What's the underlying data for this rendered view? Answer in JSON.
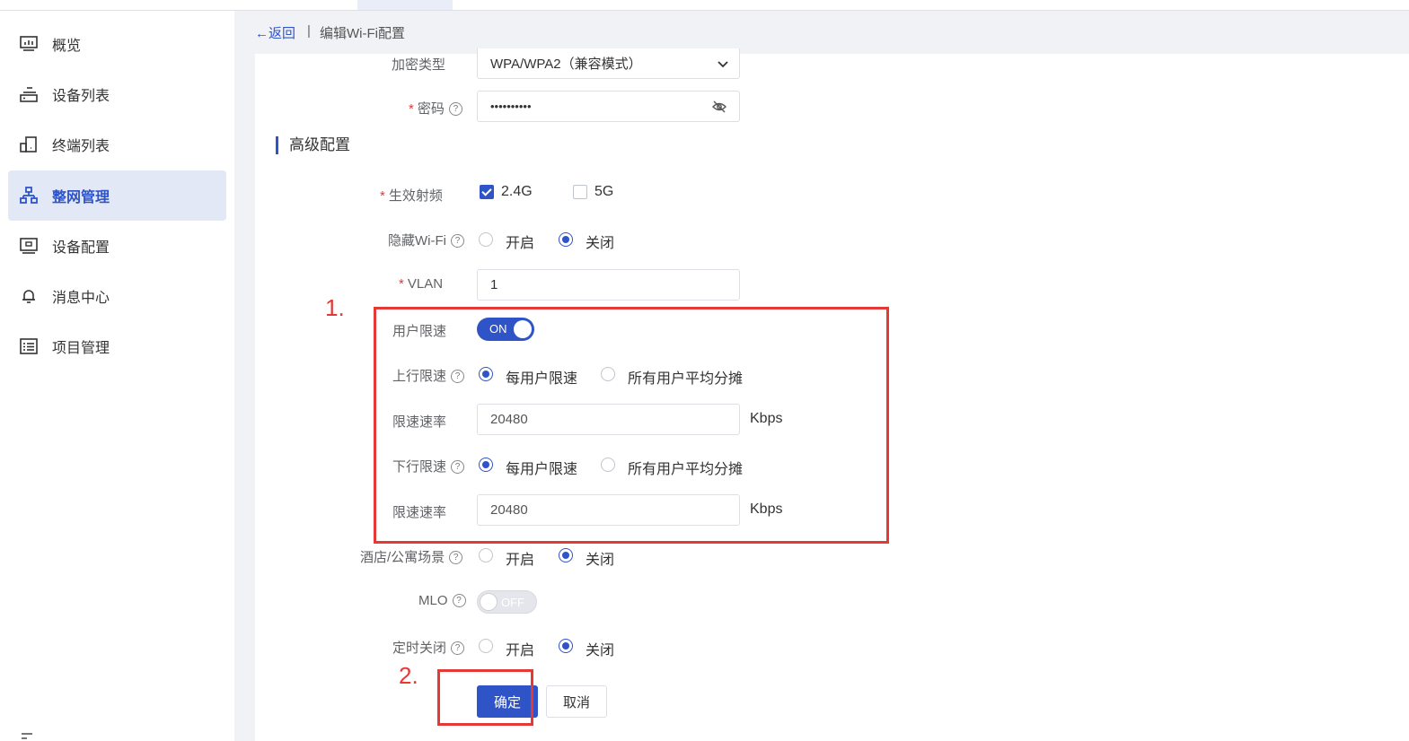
{
  "sidebar": {
    "items": [
      {
        "label": "概览",
        "icon": "monitor-chart-icon"
      },
      {
        "label": "设备列表",
        "icon": "device-stack-icon"
      },
      {
        "label": "终端列表",
        "icon": "terminal-device-icon"
      },
      {
        "label": "整网管理",
        "icon": "network-topology-icon",
        "active": true
      },
      {
        "label": "设备配置",
        "icon": "device-config-icon"
      },
      {
        "label": "消息中心",
        "icon": "bell-icon"
      },
      {
        "label": "项目管理",
        "icon": "list-icon"
      }
    ]
  },
  "breadcrumb": {
    "back": "←返回",
    "separator": "|",
    "current": "编辑Wi-Fi配置"
  },
  "form": {
    "encryption": {
      "label": "加密类型",
      "value": "WPA/WPA2（兼容模式）"
    },
    "password": {
      "required": "*",
      "label": "密码",
      "help": "?",
      "value": "••••••••••"
    },
    "advanced_title": "高级配置",
    "band": {
      "required": "*",
      "label": "生效射频",
      "options": [
        {
          "label": "2.4G",
          "checked": true
        },
        {
          "label": "5G",
          "checked": false
        }
      ]
    },
    "hide_wifi": {
      "label": "隐藏Wi-Fi",
      "help": "?",
      "on_label": "开启",
      "off_label": "关闭",
      "selected": "关闭"
    },
    "vlan": {
      "required": "*",
      "label": "VLAN",
      "value": "1"
    },
    "user_limit": {
      "label": "用户限速",
      "state": "ON"
    },
    "up_limit": {
      "label": "上行限速",
      "help": "?",
      "opt1": "每用户限速",
      "opt2": "所有用户平均分摊",
      "selected": "每用户限速"
    },
    "up_rate": {
      "label": "限速速率",
      "value": "20480",
      "unit": "Kbps"
    },
    "down_limit": {
      "label": "下行限速",
      "help": "?",
      "opt1": "每用户限速",
      "opt2": "所有用户平均分摊",
      "selected": "每用户限速"
    },
    "down_rate": {
      "label": "限速速率",
      "value": "20480",
      "unit": "Kbps"
    },
    "hotel": {
      "label": "酒店/公寓场景",
      "help": "?",
      "on_label": "开启",
      "off_label": "关闭",
      "selected": "关闭"
    },
    "mlo": {
      "label": "MLO",
      "help": "?",
      "state": "OFF"
    },
    "timer_off": {
      "label": "定时关闭",
      "help": "?",
      "on_label": "开启",
      "off_label": "关闭",
      "selected": "关闭"
    }
  },
  "buttons": {
    "confirm": "确定",
    "cancel": "取消"
  },
  "annotations": {
    "one": "1.",
    "two": "2."
  },
  "colors": {
    "primary": "#2f54c8",
    "annotation": "#e53935",
    "active_nav_bg": "#e3e8f6"
  }
}
